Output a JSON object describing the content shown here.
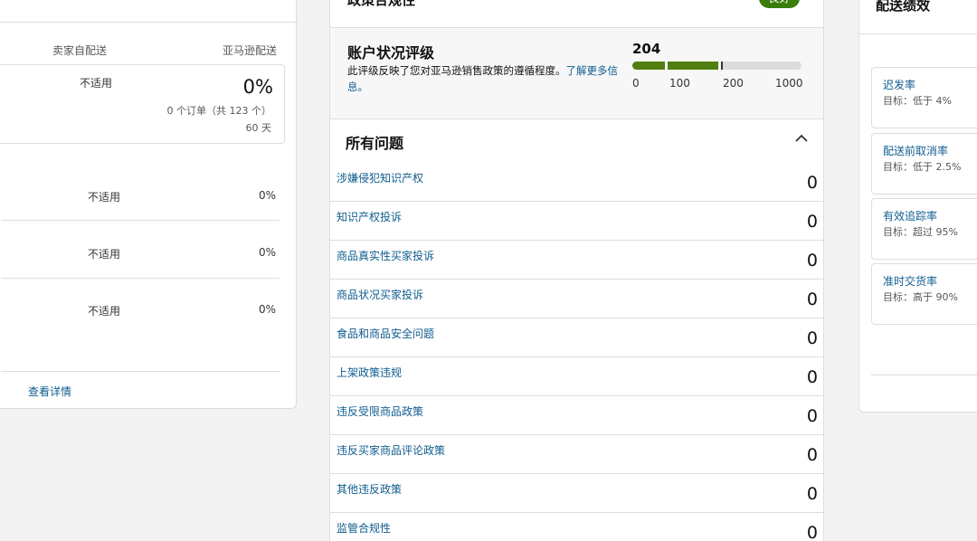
{
  "left": {
    "col_self": "卖家自配送",
    "col_amazon": "亚马逊配送",
    "card": {
      "na": "不适用",
      "pct": "0%",
      "orders": "0 个订单（共 123 个）",
      "days": "60 天"
    },
    "rows": [
      {
        "na": "不适用",
        "pct": "0%"
      },
      {
        "na": "不适用",
        "pct": "0%"
      },
      {
        "na": "不适用",
        "pct": "0%"
      }
    ],
    "link": "查看详情"
  },
  "mid": {
    "title": "政策合规性",
    "badge": "良好",
    "ahr_title": "账户状况评级",
    "ahr_desc": "此评级反映了您对亚马逊销售政策的遵循程度。",
    "ahr_link": "了解更多信息。",
    "score": "204",
    "score_value": 204,
    "ticks": [
      "0",
      "100",
      "200",
      "1000"
    ],
    "issues_title": "所有问题",
    "issues": [
      {
        "label": "涉嫌侵犯知识产权",
        "count": "0"
      },
      {
        "label": "知识产权投诉",
        "count": "0"
      },
      {
        "label": "商品真实性买家投诉",
        "count": "0"
      },
      {
        "label": "商品状况买家投诉",
        "count": "0"
      },
      {
        "label": "食品和商品安全问题",
        "count": "0"
      },
      {
        "label": "上架政策违规",
        "count": "0"
      },
      {
        "label": "违反受限商品政策",
        "count": "0"
      },
      {
        "label": "违反买家商品评论政策",
        "count": "0"
      },
      {
        "label": "其他违反政策",
        "count": "0"
      },
      {
        "label": "监管合规性",
        "count": "0"
      }
    ]
  },
  "right": {
    "title": "配送绩效",
    "metrics": [
      {
        "name": "迟发率",
        "target": "目标：低于 4%"
      },
      {
        "name": "配送前取消率",
        "target": "目标：低于 2.5%"
      },
      {
        "name": "有效追踪率",
        "target": "目标：超过 95%"
      },
      {
        "name": "准时交货率",
        "target": "目标：高于 90%"
      }
    ]
  },
  "colors": {
    "link": "#0f5c8f",
    "good": "#3a7d0a",
    "bar": "#4f7f10"
  }
}
